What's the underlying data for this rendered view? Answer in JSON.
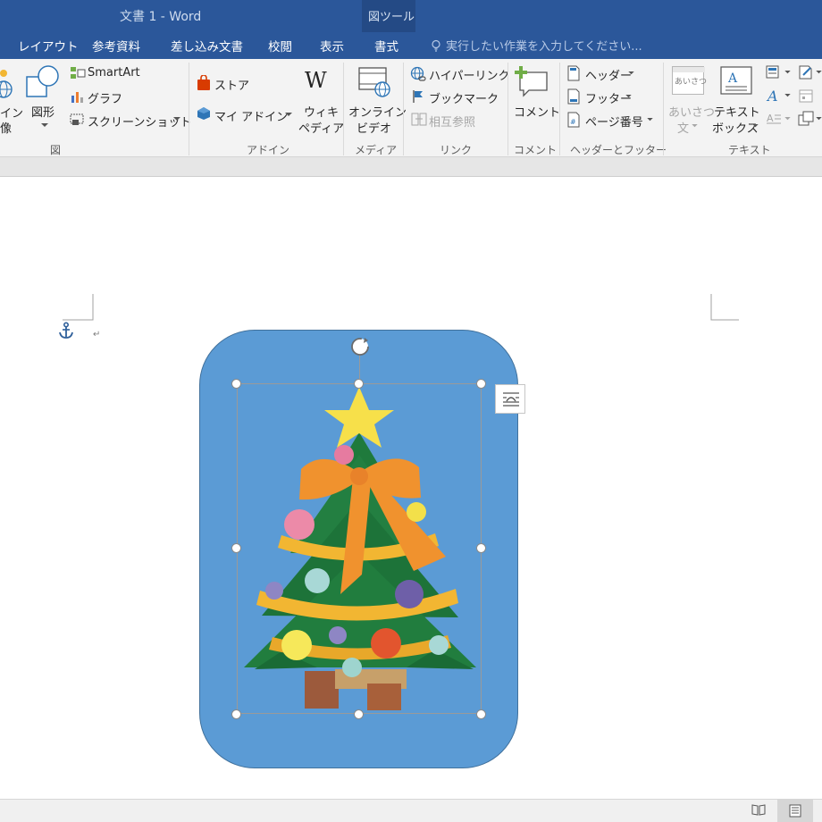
{
  "window": {
    "title": "文書 1 - Word",
    "context_group": "図ツール"
  },
  "tabs": [
    {
      "label": "レイアウト"
    },
    {
      "label": "参考資料"
    },
    {
      "label": "差し込み文書"
    },
    {
      "label": "校閲"
    },
    {
      "label": "表示"
    },
    {
      "label": "書式"
    }
  ],
  "active_tab": "書式",
  "tell_me": {
    "placeholder": "実行したい作業を入力してください..."
  },
  "ribbon": {
    "illustrations": {
      "partial_online_image": "イン",
      "partial_online_image_2": "像",
      "shapes": "図形",
      "smartart": "SmartArt",
      "chart": "グラフ",
      "screenshot": "スクリーンショット",
      "group_label": "図"
    },
    "addins": {
      "store": "ストア",
      "my_addins": "マイ アドイン",
      "wikipedia_1": "ウィキ",
      "wikipedia_2": "ペディア",
      "group_label": "アドイン"
    },
    "media": {
      "online_video_1": "オンライン",
      "online_video_2": "ビデオ",
      "group_label": "メディア"
    },
    "links": {
      "hyperlink": "ハイパーリンク",
      "bookmark": "ブックマーク",
      "cross_reference": "相互参照",
      "group_label": "リンク"
    },
    "comments": {
      "comment": "コメント",
      "group_label": "コメント"
    },
    "header_footer": {
      "header": "ヘッダー",
      "footer": "フッター",
      "page_number": "ページ番号",
      "group_label": "ヘッダーとフッター"
    },
    "text": {
      "greeting_icon_text": "あいさつ",
      "greeting_1": "あいさつ",
      "greeting_2": "文",
      "textbox_1": "テキスト",
      "textbox_2": "ボックス",
      "group_label": "テキスト"
    }
  },
  "document": {
    "paragraph_mark": "↵"
  },
  "colors": {
    "title_bar": "#2b579a",
    "shape_fill": "#5b9bd5",
    "shape_border": "#41719c"
  }
}
